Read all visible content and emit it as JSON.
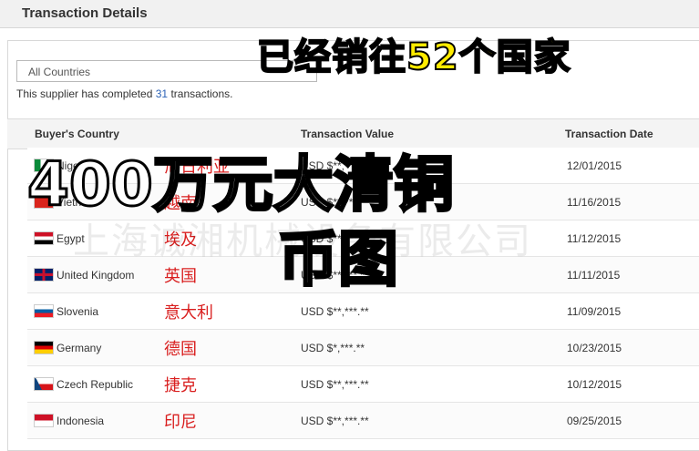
{
  "header": {
    "title": "Transaction Details"
  },
  "filter": {
    "value": "All Countries"
  },
  "summary": {
    "prefix": "This supplier has completed ",
    "count": "31",
    "suffix": " transactions."
  },
  "table": {
    "headers": {
      "country": "Buyer's Country",
      "value": "Transaction Value",
      "date": "Transaction Date"
    },
    "rows": [
      {
        "country": "Nigeria",
        "cn": "尼日利亚",
        "value": "USD $**,***.**",
        "date": "12/01/2015",
        "flag": "nigeria"
      },
      {
        "country": "Vietnam",
        "cn": "越南",
        "value": "USD $**,***.**",
        "date": "11/16/2015",
        "flag": "vietnam"
      },
      {
        "country": "Egypt",
        "cn": "埃及",
        "value": "USD $**,***.**",
        "date": "11/12/2015",
        "flag": "egypt"
      },
      {
        "country": "United Kingdom",
        "cn": "英国",
        "value": "USD $**,***.**",
        "date": "11/11/2015",
        "flag": "uk"
      },
      {
        "country": "Slovenia",
        "cn": "意大利",
        "value": "USD $**,***.**",
        "date": "11/09/2015",
        "flag": "slovenia"
      },
      {
        "country": "Germany",
        "cn": "德国",
        "value": "USD $*,***.**",
        "date": "10/23/2015",
        "flag": "germany"
      },
      {
        "country": "Czech Republic",
        "cn": "捷克",
        "value": "USD $**,***.**",
        "date": "10/12/2015",
        "flag": "czech"
      },
      {
        "country": "Indonesia",
        "cn": "印尼",
        "value": "USD $**,***.**",
        "date": "09/25/2015",
        "flag": "indonesia"
      }
    ]
  },
  "watermark": "上海诚湘机械设备有限公司",
  "overlay": {
    "line1": "已经销往52个国家",
    "line2": "400万元大清铜",
    "line3": "币图"
  },
  "colors": {
    "overlay_yellow": "#ffeb00",
    "cn_red": "#d91f1f",
    "link_blue": "#2b62b6"
  }
}
